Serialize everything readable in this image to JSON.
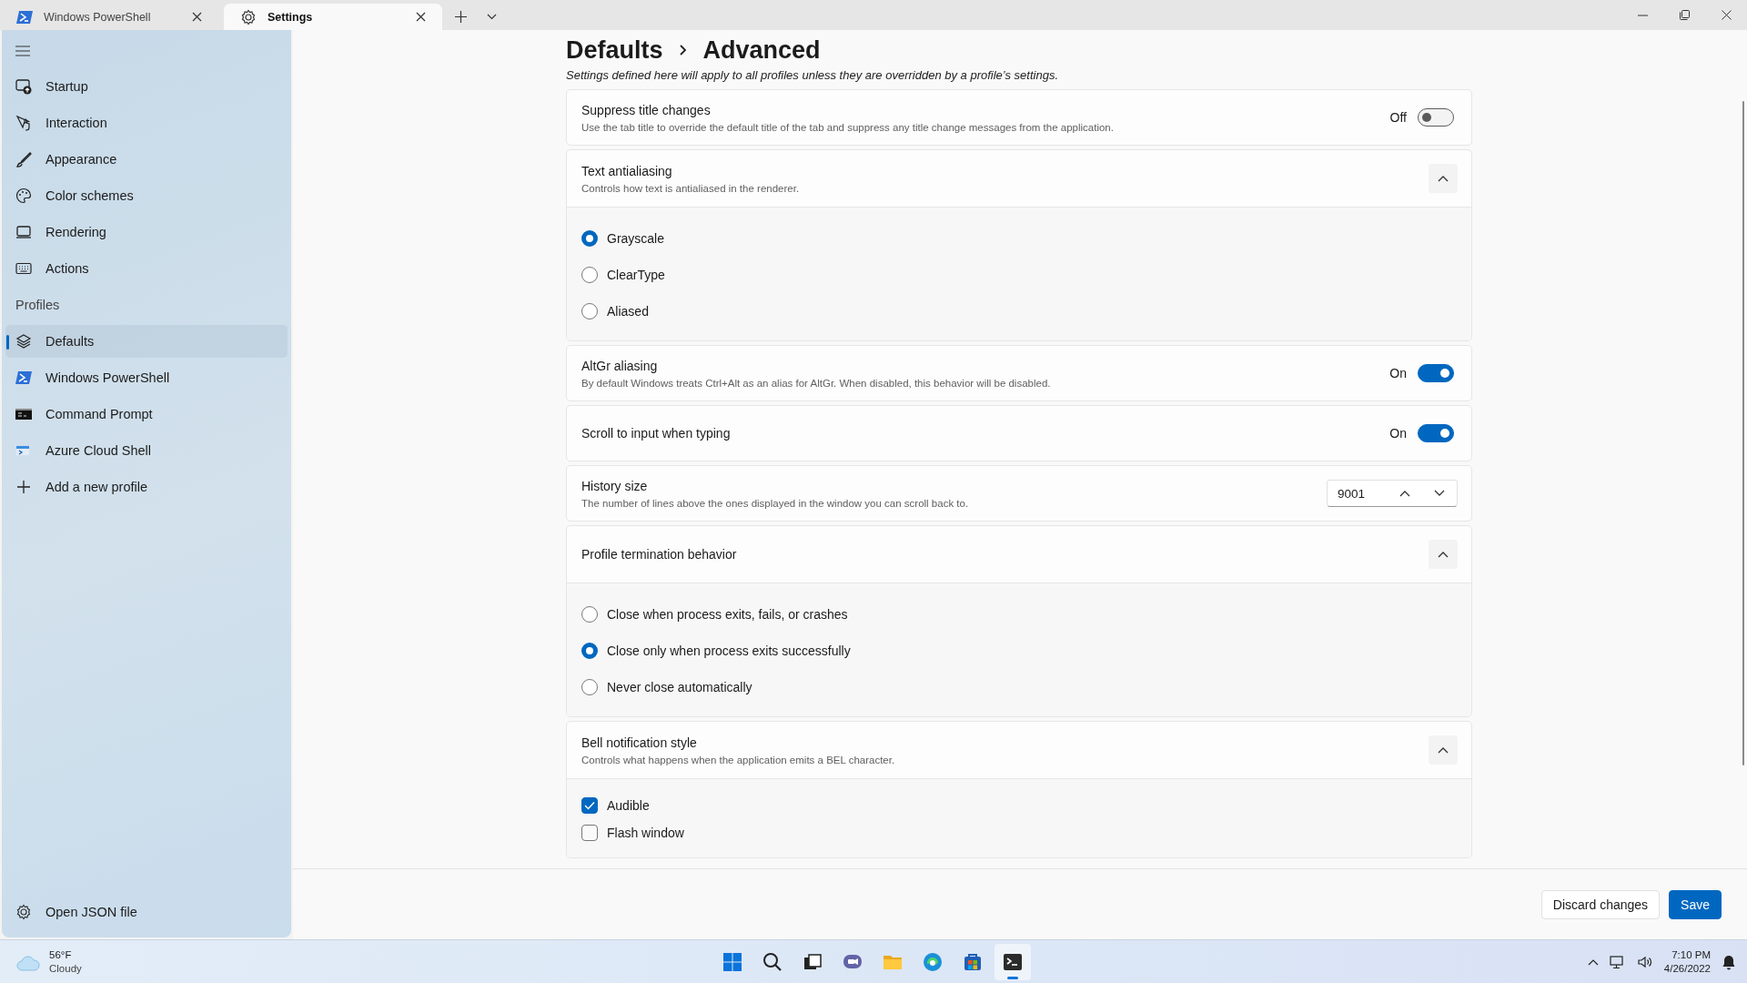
{
  "tabs": [
    {
      "title": "Windows PowerShell",
      "selected": false
    },
    {
      "title": "Settings",
      "selected": true
    }
  ],
  "sidebar": {
    "items": [
      {
        "label": "Startup",
        "selected": false
      },
      {
        "label": "Interaction",
        "selected": false
      },
      {
        "label": "Appearance",
        "selected": false
      },
      {
        "label": "Color schemes",
        "selected": false
      },
      {
        "label": "Rendering",
        "selected": false
      },
      {
        "label": "Actions",
        "selected": false
      }
    ],
    "section_label": "Profiles",
    "profiles": [
      {
        "label": "Defaults",
        "selected": true
      },
      {
        "label": "Windows PowerShell",
        "selected": false
      },
      {
        "label": "Command Prompt",
        "selected": false
      },
      {
        "label": "Azure Cloud Shell",
        "selected": false
      },
      {
        "label": "Add a new profile",
        "selected": false
      }
    ],
    "footer_item": {
      "label": "Open JSON file"
    }
  },
  "page": {
    "breadcrumb": [
      "Defaults",
      "Advanced"
    ],
    "subtitle": "Settings defined here will apply to all profiles unless they are overridden by a profile’s settings.",
    "settings": [
      {
        "kind": "toggle",
        "title": "Suppress title changes",
        "description": "Use the tab title to override the default title of the tab and suppress any title change messages from the application.",
        "state_label": "Off",
        "on": false
      },
      {
        "kind": "radio_group",
        "title": "Text antialiasing",
        "description": "Controls how text is antialiased in the renderer.",
        "expanded": true,
        "options": [
          {
            "label": "Grayscale",
            "selected": true
          },
          {
            "label": "ClearType",
            "selected": false
          },
          {
            "label": "Aliased",
            "selected": false
          }
        ]
      },
      {
        "kind": "toggle",
        "title": "AltGr aliasing",
        "description": "By default Windows treats Ctrl+Alt as an alias for AltGr. When disabled, this behavior will be disabled.",
        "state_label": "On",
        "on": true
      },
      {
        "kind": "toggle",
        "title": "Scroll to input when typing",
        "state_label": "On",
        "on": true
      },
      {
        "kind": "number",
        "title": "History size",
        "description": "The number of lines above the ones displayed in the window you can scroll back to.",
        "value": "9001"
      },
      {
        "kind": "radio_group",
        "title": "Profile termination behavior",
        "expanded": true,
        "options": [
          {
            "label": "Close when process exits, fails, or crashes",
            "selected": false
          },
          {
            "label": "Close only when process exits successfully",
            "selected": true
          },
          {
            "label": "Never close automatically",
            "selected": false
          }
        ]
      },
      {
        "kind": "checkbox_group",
        "title": "Bell notification style",
        "description": "Controls what happens when the application emits a BEL character.",
        "expanded": true,
        "options": [
          {
            "label": "Audible",
            "checked": true
          },
          {
            "label": "Flash window",
            "checked": false
          }
        ]
      }
    ]
  },
  "footer": {
    "buttons": [
      {
        "label": "Discard changes",
        "kind": "secondary"
      },
      {
        "label": "Save",
        "kind": "primary"
      }
    ]
  },
  "taskbar": {
    "weather": {
      "temperature": "56°F",
      "condition": "Cloudy"
    },
    "apps": [
      {
        "active": false
      },
      {
        "active": false
      },
      {
        "active": false
      },
      {
        "active": false
      },
      {
        "active": false
      },
      {
        "active": false
      },
      {
        "active": false
      },
      {
        "active": true
      }
    ],
    "clock": {
      "time": "7:10 PM",
      "date": "4/26/2022"
    }
  }
}
